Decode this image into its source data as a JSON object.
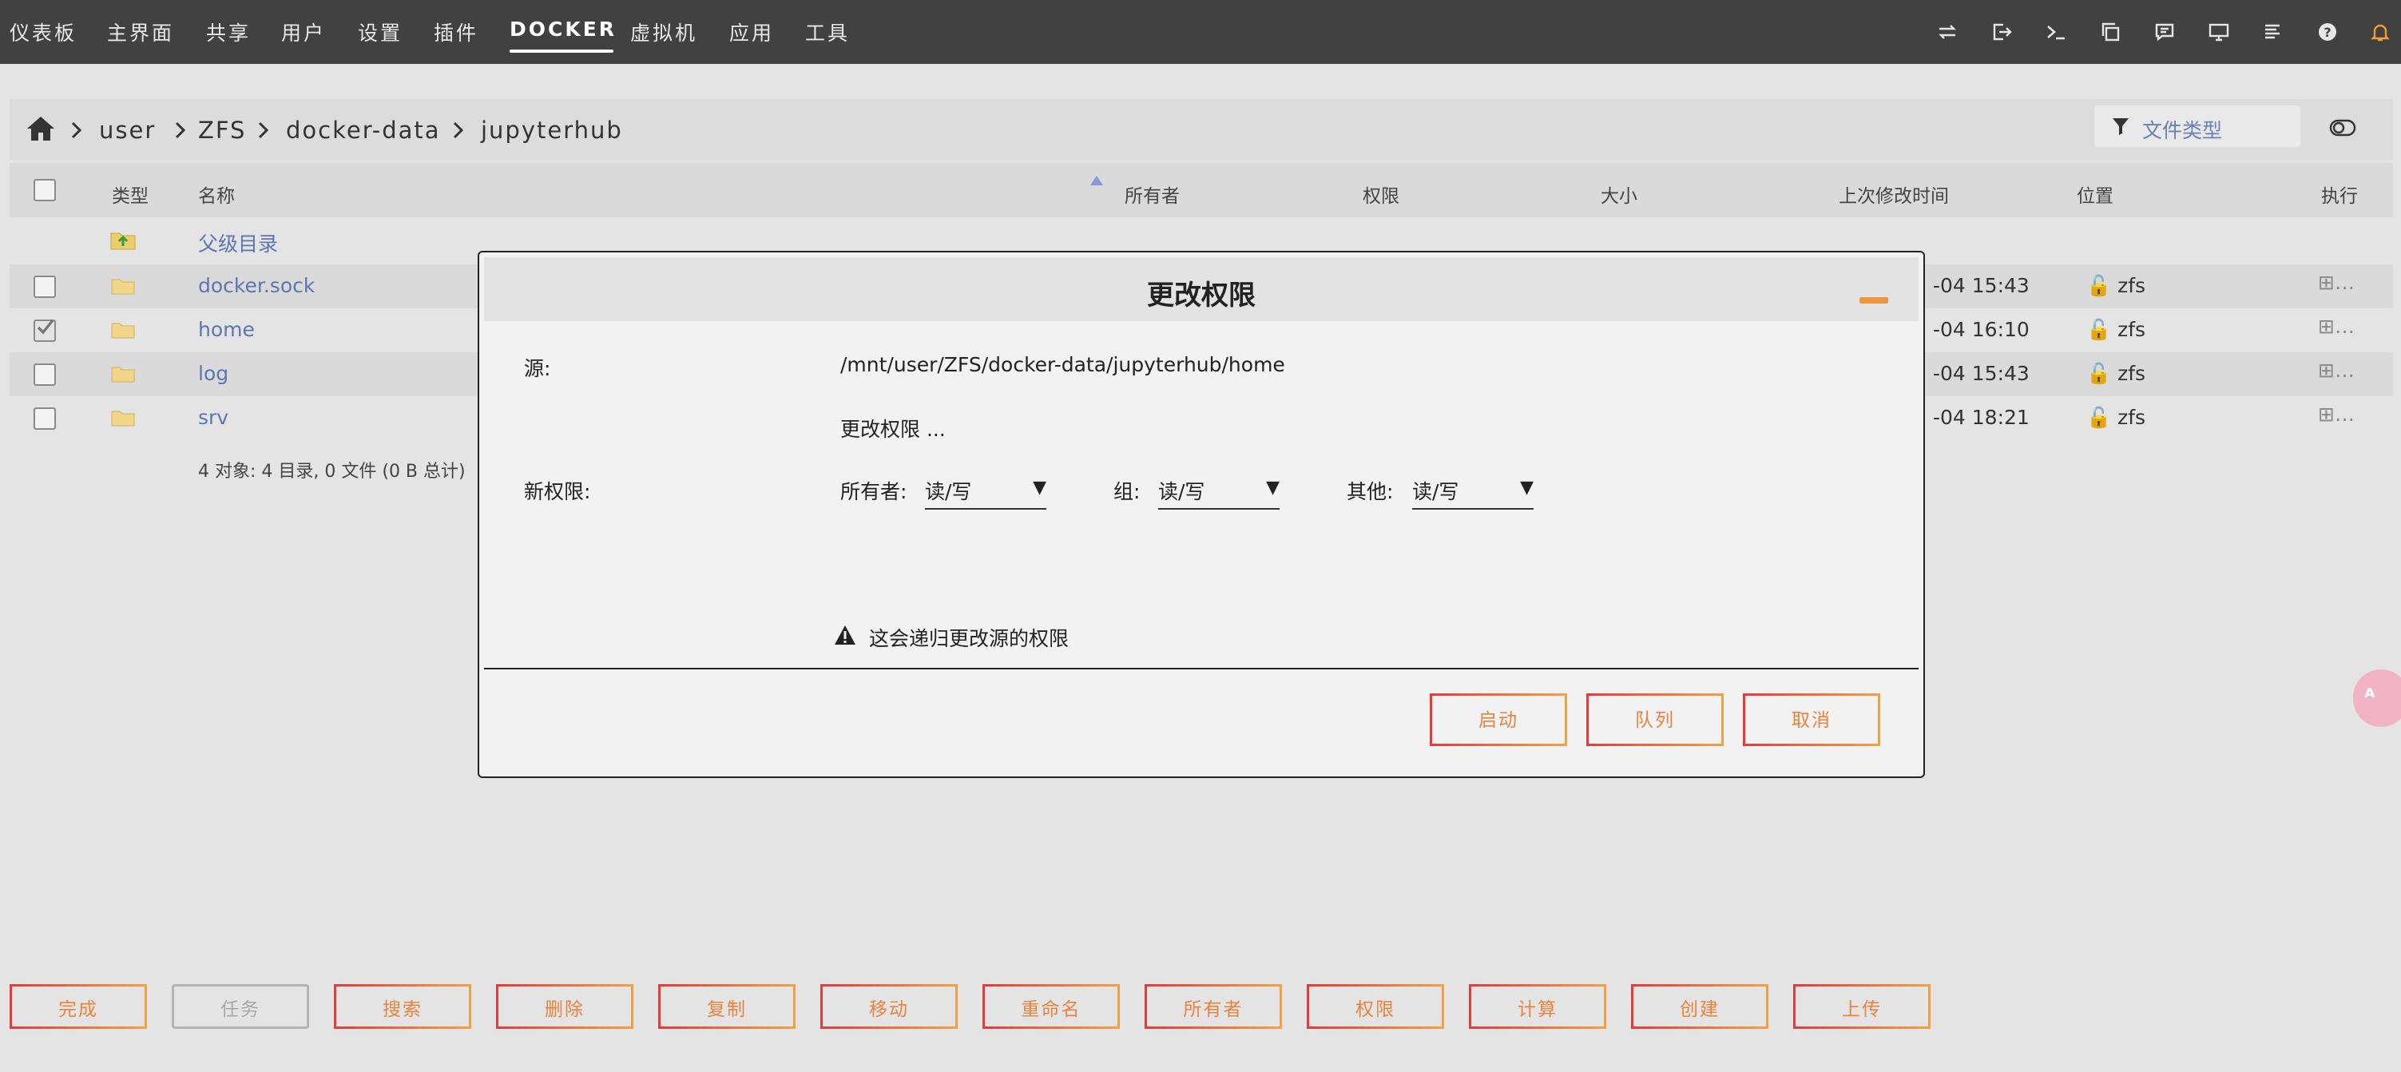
{
  "nav": {
    "items": [
      "仪表板",
      "主界面",
      "共享",
      "用户",
      "设置",
      "插件",
      "DOCKER",
      "虚拟机",
      "应用",
      "工具"
    ],
    "active": "DOCKER",
    "icons": [
      "switch-icon",
      "logout-icon",
      "terminal-icon",
      "copy-icon",
      "feedback-icon",
      "monitor-icon",
      "log-icon",
      "help-icon",
      "bell-icon"
    ]
  },
  "breadcrumb": {
    "home_icon": "home-icon",
    "items": [
      "user",
      "ZFS",
      "docker-data",
      "jupyterhub"
    ]
  },
  "filter": {
    "placeholder": "文件类型",
    "icon": "filter-icon",
    "toggle_icon": "toggle-icon"
  },
  "table": {
    "headers": {
      "type": "类型",
      "name": "名称",
      "owner": "所有者",
      "perm": "权限",
      "size": "大小",
      "modified": "上次修改时间",
      "location": "位置",
      "action": "执行"
    },
    "parent_label": "父级目录",
    "rows": [
      {
        "name": "docker.sock",
        "time": "-04 15:43",
        "location": "zfs",
        "checked": false
      },
      {
        "name": "home",
        "time": "-04 16:10",
        "location": "zfs",
        "checked": true
      },
      {
        "name": "log",
        "time": "-04 15:43",
        "location": "zfs",
        "checked": false
      },
      {
        "name": "srv",
        "time": "-04 18:21",
        "location": "zfs",
        "checked": false
      }
    ],
    "summary": "4 对象: 4 目录, 0 文件 (0 B 总计)"
  },
  "modal": {
    "title": "更改权限",
    "source_label": "源:",
    "source_path": "/mnt/user/ZFS/docker-data/jupyterhub/home",
    "action_text": "更改权限 ...",
    "new_perm_label": "新权限:",
    "owner_label": "所有者:",
    "owner_value": "读/写",
    "group_label": "组:",
    "group_value": "读/写",
    "other_label": "其他:",
    "other_value": "读/写",
    "warning": "这会递归更改源的权限",
    "buttons": {
      "start": "启动",
      "queue": "队列",
      "cancel": "取消"
    }
  },
  "toolbar": {
    "buttons": [
      "完成",
      "任务",
      "搜索",
      "删除",
      "复制",
      "移动",
      "重命名",
      "所有者",
      "权限",
      "计算",
      "创建",
      "上传"
    ],
    "disabled": [
      "任务"
    ]
  },
  "colors": {
    "accent": "#e8833f",
    "link": "#5d76b3",
    "nav_bg": "#414141"
  }
}
